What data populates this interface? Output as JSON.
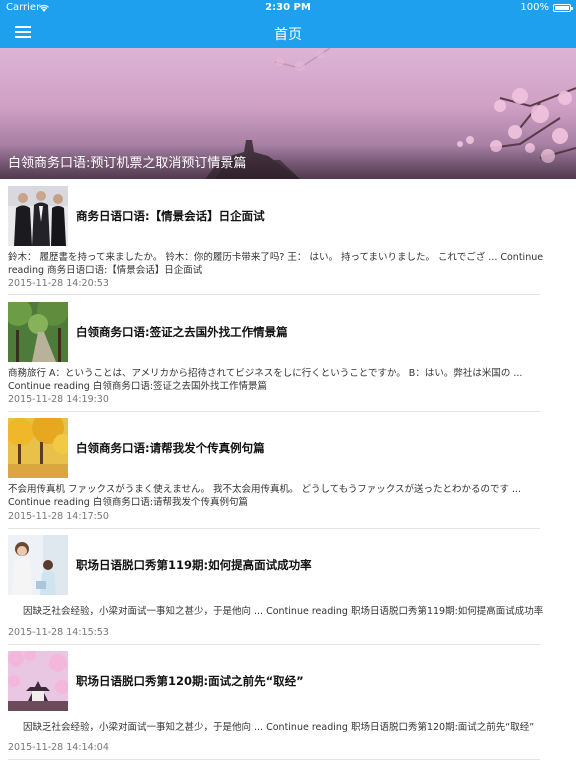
{
  "status_bar": {
    "carrier": "Carrier",
    "time": "2:30 PM",
    "battery": "100%"
  },
  "nav": {
    "title": "首页"
  },
  "hero": {
    "caption": "白领商务口语:预订机票之取消预订情景篇"
  },
  "articles": [
    {
      "title": "商务日语口语:【情景会话】日企面试",
      "snippet": "鈴木： 履歴書を持って来ましたか。 铃木：你的履历卡带来了吗? 王： はい。 持ってまいりました。 これでござ ... Continue reading 商务日语口语:【情景会话】日企面试",
      "date": "2015-11-28 14:20:53",
      "thumb": "business-people"
    },
    {
      "title": "白领商务口语:签证之去国外找工作情景篇",
      "snippet": "商務旅行 A：ということは、アメリカから招待されてビジネスをしに行くということですか。 B：はい。弊社は米国の ... Continue reading 白领商务口语:签证之去国外找工作情景篇",
      "date": "2015-11-28 14:19:30",
      "thumb": "green-path"
    },
    {
      "title": "白领商务口语:请帮我发个传真例句篇",
      "snippet": "不会用传真机 ファックスがうまく使えません。 我不太会用传真机。 どうしてもうファックスが送ったとわかるのです ... Continue reading 白领商务口语:请帮我发个传真例句篇",
      "date": "2015-11-28 14:17:50",
      "thumb": "autumn-trees"
    },
    {
      "title": "职场日语脱口秀第119期:如何提高面试成功率",
      "snippet": "因缺乏社会经验，小梁对面试一事知之甚少，于是他向 ... Continue reading 职场日语脱口秀第119期:如何提高面试成功率",
      "date": "2015-11-28 14:15:53",
      "thumb": "office-women"
    },
    {
      "title": "职场日语脱口秀第120期:面试之前先“取经”",
      "snippet": "因缺乏社会经验，小梁对面试一事知之甚少，于是他向 ... Continue reading 职场日语脱口秀第120期:面试之前先“取经”",
      "date": "2015-11-28 14:14:04",
      "thumb": "castle-blossom"
    }
  ],
  "colors": {
    "accent": "#1ea0ee",
    "date_text": "#777777",
    "divider": "#e4e4e4"
  }
}
